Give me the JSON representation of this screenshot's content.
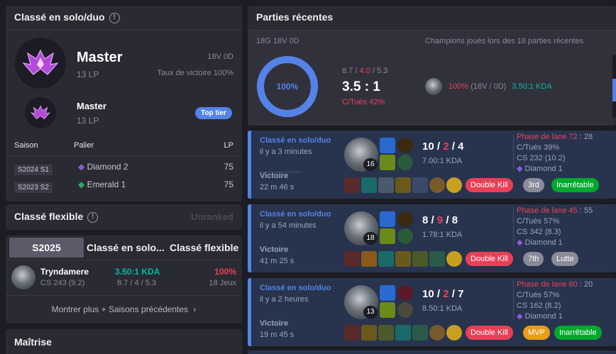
{
  "colors": {
    "accent": "#5383e8",
    "red": "#e84057",
    "teal": "#00bba3",
    "win_bar": "#5383e8",
    "badge_red": "#e84057",
    "badge_grey": "#8a8a98",
    "badge_green": "#00a82c",
    "badge_gold": "#e89d1b"
  },
  "solo": {
    "title": "Classé en solo/duo",
    "tier": "Master",
    "lp": "13 LP",
    "record": "18V 0D",
    "winrate": "Taux de victoire 100%",
    "tier2": "Master",
    "lp2": "13 LP",
    "top_tier": "Top tier",
    "headers": {
      "season": "Saison",
      "tier": "Palier",
      "lp": "LP"
    },
    "seasons": [
      {
        "season": "S2024 S1",
        "tier": "Diamond 2",
        "lp": "75",
        "icon": "diamond-icon"
      },
      {
        "season": "S2023 S2",
        "tier": "Emerald 1",
        "lp": "75",
        "icon": "emerald-icon"
      }
    ]
  },
  "flex": {
    "title": "Classé flexible",
    "status": "Unranked"
  },
  "tabs": [
    "S2025",
    "Classé en solo...",
    "Classé flexible"
  ],
  "champ_row": {
    "name": "Tryndamere",
    "cs": "CS 243 (9.2)",
    "kda": "3.50:1 KDA",
    "kda_detail": "8.7 / 4 / 5.3",
    "winrate": "100%",
    "games": "18 Jeux"
  },
  "show_more": "Montrer plus + Saisons précédentes",
  "mastery": {
    "title": "Maîtrise"
  },
  "recent": {
    "title": "Parties récentes",
    "record": "18G 18V 0D",
    "donut_label": "100%",
    "winrate": 100,
    "kda_k": "8.7",
    "kda_d": "4.0",
    "kda_a": "5.3",
    "sep": "/",
    "ratio": "3.5 : 1",
    "kp": "C/Tués 42%",
    "champs_title": "Champions joués lors des 18 parties récentes",
    "champ_wr": "100%",
    "champ_record": "(18V / 0D)",
    "champ_kda": "3.50:1 KDA"
  },
  "matches": [
    {
      "queue": "Classé en solo/duo",
      "ago": "il y a 3 minutes",
      "result": "Victoire",
      "duration": "22 m 46 s",
      "level": "16",
      "k": "10",
      "d": "2",
      "a": "4",
      "kda": "7.00:1 KDA",
      "lane_label": "Phase de lane",
      "lane_a": "72",
      "lane_b": "28",
      "kp": "C/Tués 39%",
      "cs": "CS 232 (10.2)",
      "rank": "Diamond 1",
      "badges": [
        "Double Kill",
        "3rd",
        "Inarrêtable"
      ]
    },
    {
      "queue": "Classé en solo/duo",
      "ago": "il y a 54 minutes",
      "result": "Victoire",
      "duration": "41 m 25 s",
      "level": "18",
      "k": "8",
      "d": "9",
      "a": "8",
      "kda": "1.78:1 KDA",
      "lane_label": "Phase de lane",
      "lane_a": "45",
      "lane_b": "55",
      "kp": "C/Tués 57%",
      "cs": "CS 342 (8.3)",
      "rank": "Diamond 1",
      "badges": [
        "Double Kill",
        "7th",
        "Lutte"
      ]
    },
    {
      "queue": "Classé en solo/duo",
      "ago": "il y a 2 heures",
      "result": "Victoire",
      "duration": "19 m 45 s",
      "level": "13",
      "k": "10",
      "d": "2",
      "a": "7",
      "kda": "8.50:1 KDA",
      "lane_label": "Phase de lane",
      "lane_a": "80",
      "lane_b": "20",
      "kp": "C/Tués 57%",
      "cs": "CS 162 (8.2)",
      "rank": "Diamond 1",
      "badges": [
        "Double Kill",
        "MVP",
        "Inarrêtable"
      ]
    }
  ]
}
